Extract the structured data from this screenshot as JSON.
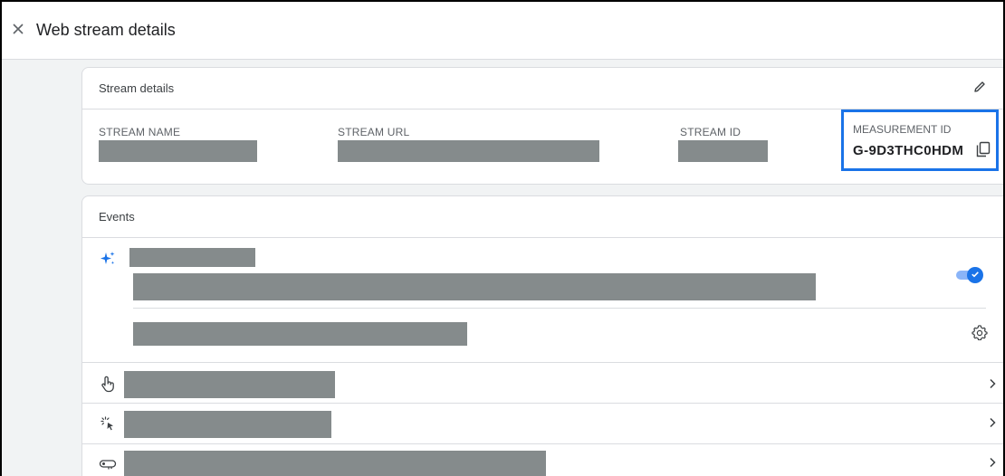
{
  "header": {
    "title": "Web stream details",
    "close_icon": "close-icon"
  },
  "stream_details": {
    "title": "Stream details",
    "edit_icon": "pencil-icon",
    "fields": {
      "stream_name_label": "STREAM NAME",
      "stream_url_label": "STREAM URL",
      "stream_id_label": "STREAM ID",
      "measurement_id_label": "MEASUREMENT ID",
      "measurement_id_value": "G-9D3THC0HDM"
    },
    "copy_icon": "copy-icon",
    "highlight_color": "#1a73e8"
  },
  "events": {
    "title": "Events",
    "enhanced_measurement": {
      "icon": "sparkle-icon",
      "toggle_on": true,
      "settings_icon": "gear-icon"
    },
    "rows": [
      {
        "icon": "touch-icon",
        "chevron": "chevron-right-icon"
      },
      {
        "icon": "click-icon",
        "chevron": "chevron-right-icon"
      },
      {
        "icon": "key-icon",
        "chevron": "chevron-right-icon"
      }
    ]
  },
  "colors": {
    "accent": "#1a73e8",
    "redaction": "#858b8c",
    "background": "#f1f3f4"
  }
}
